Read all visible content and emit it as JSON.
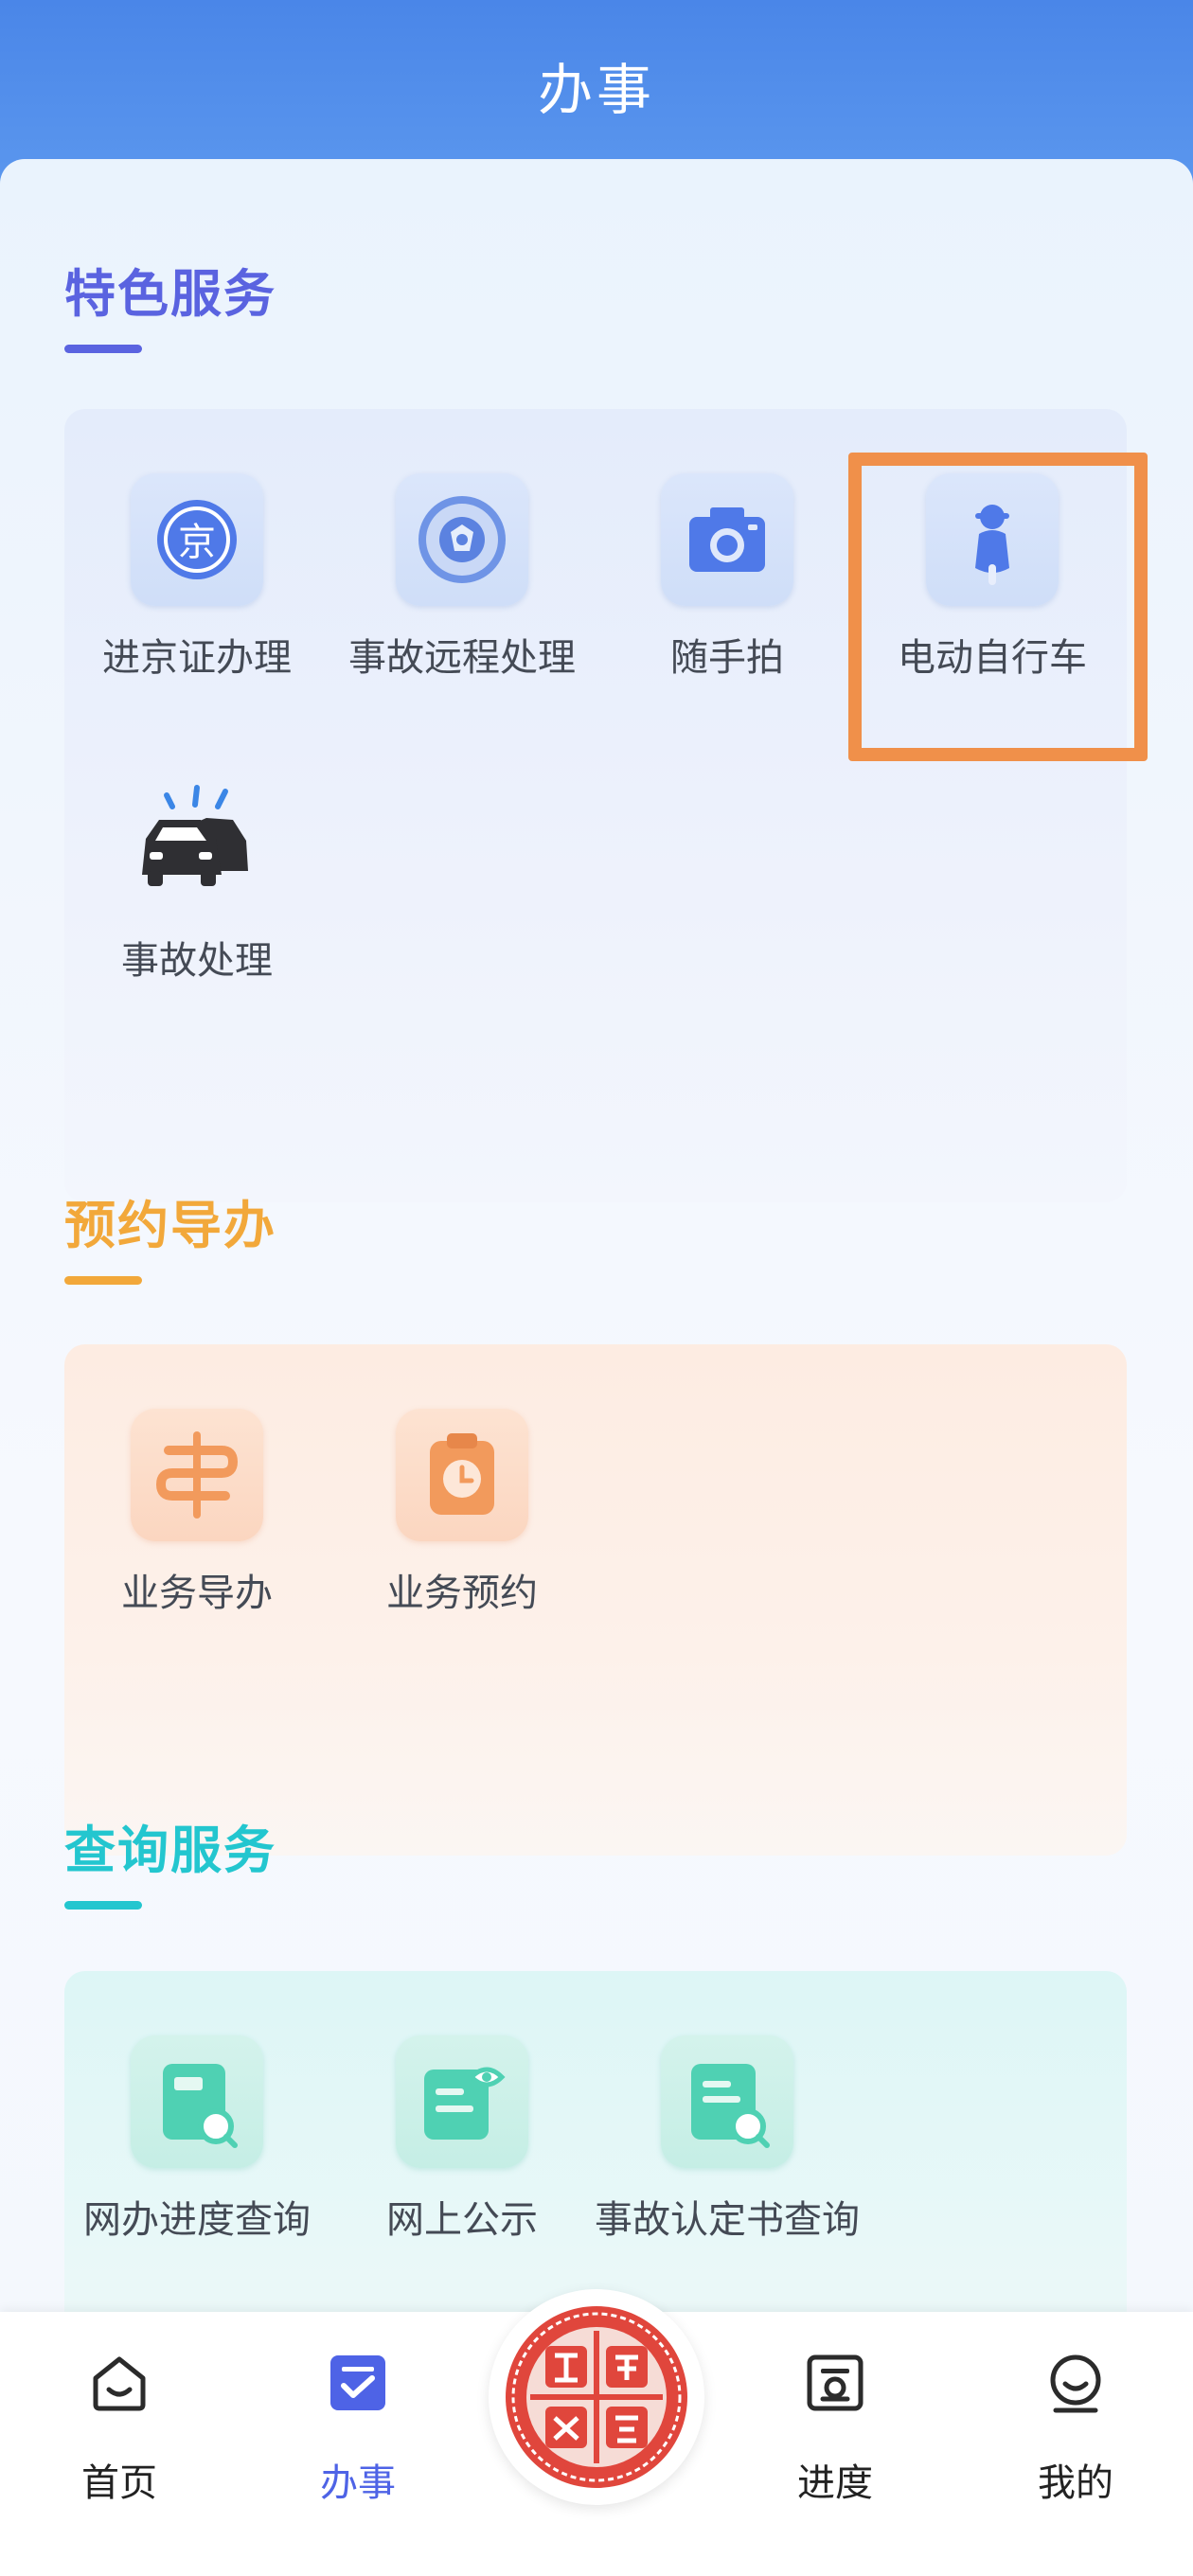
{
  "header": {
    "title": "办事"
  },
  "sections": {
    "featured": {
      "title": "特色服务",
      "color": "#5a63e0",
      "items": [
        {
          "label": "进京证办理",
          "icon": "jing-badge-icon"
        },
        {
          "label": "事故远程处理",
          "icon": "police-emblem-icon"
        },
        {
          "label": "随手拍",
          "icon": "camera-icon"
        },
        {
          "label": "电动自行车",
          "icon": "e-bike-icon"
        },
        {
          "label": "事故处理",
          "icon": "car-accident-icon"
        }
      ]
    },
    "appointment": {
      "title": "预约导办",
      "color": "#f2a83a",
      "items": [
        {
          "label": "业务导办",
          "icon": "route-icon"
        },
        {
          "label": "业务预约",
          "icon": "appointment-clock-icon"
        }
      ]
    },
    "query": {
      "title": "查询服务",
      "color": "#23c6cf",
      "items": [
        {
          "label": "网办进度查询",
          "icon": "progress-search-icon"
        },
        {
          "label": "网上公示",
          "icon": "public-notice-icon"
        },
        {
          "label": "事故认定书查询",
          "icon": "report-search-icon"
        }
      ]
    }
  },
  "tabbar": {
    "home": "首页",
    "tasks": "办事",
    "progress": "进度",
    "mine": "我的",
    "logo_icon": "beijing-traffic-police-seal"
  },
  "colors": {
    "accent": "#4e63e6",
    "highlight": "#f0904a"
  }
}
